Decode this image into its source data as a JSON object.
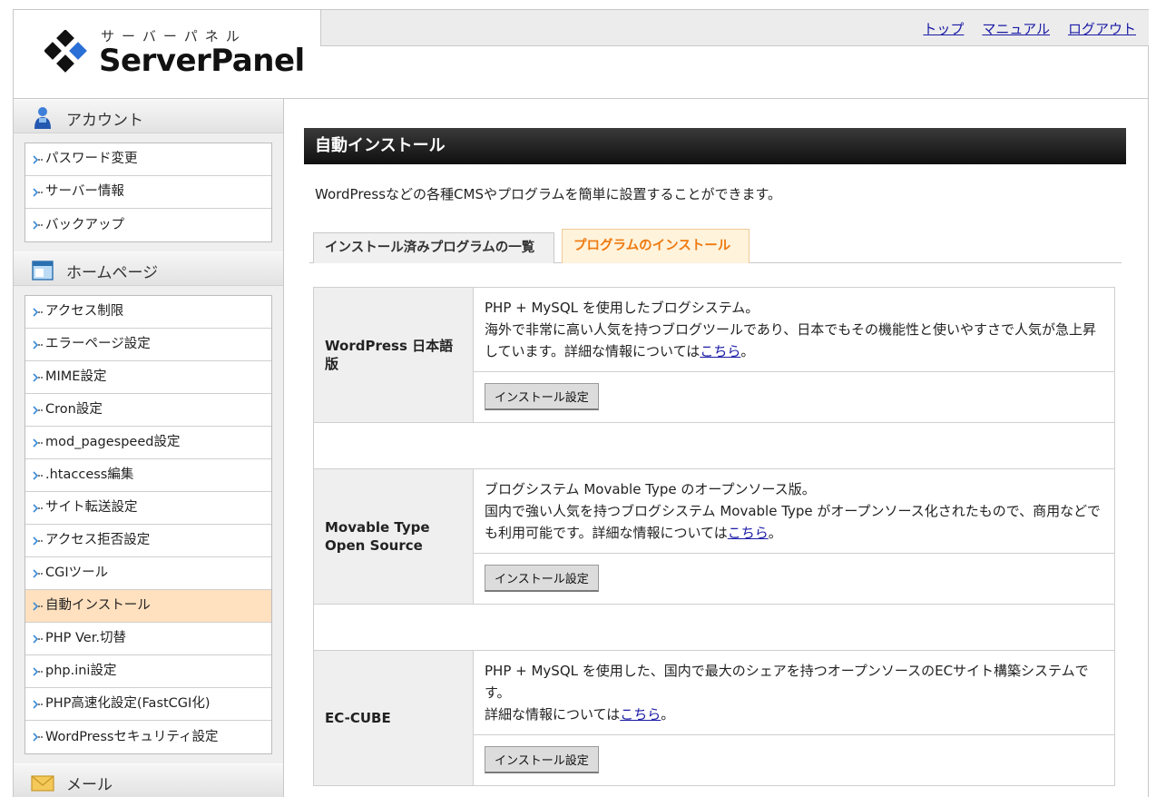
{
  "header": {
    "logo_kana": "サーバーパネル",
    "logo_text": "ServerPanel",
    "links": [
      "トップ",
      "マニュアル",
      "ログアウト"
    ]
  },
  "sidebar": {
    "sections": [
      {
        "title": "アカウント",
        "icon": "user-icon",
        "items": [
          {
            "label": "パスワード変更"
          },
          {
            "label": "サーバー情報"
          },
          {
            "label": "バックアップ"
          }
        ]
      },
      {
        "title": "ホームページ",
        "icon": "window-icon",
        "items": [
          {
            "label": "アクセス制限"
          },
          {
            "label": "エラーページ設定"
          },
          {
            "label": "MIME設定"
          },
          {
            "label": "Cron設定"
          },
          {
            "label": "mod_pagespeed設定"
          },
          {
            "label": ".htaccess編集"
          },
          {
            "label": "サイト転送設定"
          },
          {
            "label": "アクセス拒否設定"
          },
          {
            "label": "CGIツール"
          },
          {
            "label": "自動インストール",
            "active": true
          },
          {
            "label": "PHP Ver.切替"
          },
          {
            "label": "php.ini設定"
          },
          {
            "label": "PHP高速化設定(FastCGI化)"
          },
          {
            "label": "WordPressセキュリティ設定"
          }
        ]
      },
      {
        "title": "メール",
        "icon": "mail-icon",
        "items": []
      }
    ]
  },
  "main": {
    "title": "自動インストール",
    "description": "WordPressなどの各種CMSやプログラムを簡単に設置することができます。",
    "tabs": [
      {
        "label": "インストール済みプログラムの一覧",
        "active": false
      },
      {
        "label": "プログラムのインストール",
        "active": true
      }
    ],
    "programs": [
      {
        "name": "WordPress 日本語版",
        "desc_lines": [
          "PHP + MySQL を使用したブログシステム。",
          "海外で非常に高い人気を持つブログツールであり、日本でもその機能性と使いやすさで人気が急上昇しています。詳細な情報については"
        ],
        "link": "こちら",
        "suffix": "。",
        "button": "インストール設定"
      },
      {
        "name": "Movable Type Open Source",
        "desc_lines": [
          "ブログシステム Movable Type のオープンソース版。",
          "国内で強い人気を持つブログシステム Movable Type がオープンソース化されたもので、商用などでも利用可能です。詳細な情報については"
        ],
        "link": "こちら",
        "suffix": "。",
        "button": "インストール設定"
      },
      {
        "name": "EC-CUBE",
        "desc_lines": [
          "PHP + MySQL を使用した、国内で最大のシェアを持つオープンソースのECサイト構築システムです。",
          "詳細な情報については"
        ],
        "link": "こちら",
        "suffix": "。",
        "button": "インストール設定"
      }
    ]
  },
  "colors": {
    "active_item_bg": "#ffe0bf",
    "active_tab_text": "#ee7a10",
    "link": "#1a1aa6",
    "title_bar": "#1a1a1a"
  }
}
